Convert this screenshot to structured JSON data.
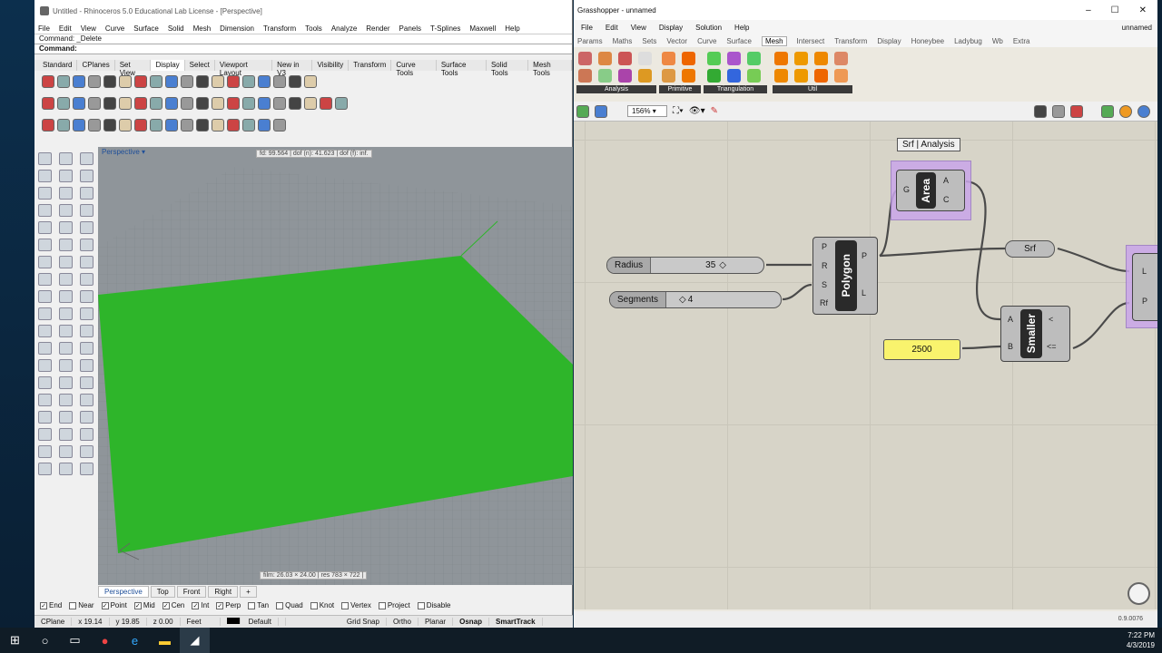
{
  "rhino": {
    "title": "Untitled - Rhinoceros 5.0 Educational Lab License - [Perspective]",
    "menu": [
      "File",
      "Edit",
      "View",
      "Curve",
      "Surface",
      "Solid",
      "Mesh",
      "Dimension",
      "Transform",
      "Tools",
      "Analyze",
      "Render",
      "Panels",
      "T-Splines",
      "Maxwell",
      "Help"
    ],
    "command_history": "Command: _Delete",
    "command_prompt": "Command:",
    "toolbar_tabs": [
      "Standard",
      "CPlanes",
      "Set View",
      "Display",
      "Select",
      "Viewport Layout",
      "New in V3",
      "Visibility",
      "Transform",
      "Curve Tools",
      "Surface Tools",
      "Solid Tools",
      "Mesh Tools"
    ],
    "active_tab": "Display",
    "viewport_title": "Perspective",
    "viewport_info_top": "fd: 99.564  |  dof (n): 41.623  |  dof (f): inf.",
    "viewport_info_bottom": "film: 26.03 × 24.00  |  res 783 × 722  |  ",
    "view_tabs": [
      "Perspective",
      "Top",
      "Front",
      "Right"
    ],
    "osnaps": [
      {
        "label": "End",
        "checked": true
      },
      {
        "label": "Near",
        "checked": false
      },
      {
        "label": "Point",
        "checked": true
      },
      {
        "label": "Mid",
        "checked": true
      },
      {
        "label": "Cen",
        "checked": true
      },
      {
        "label": "Int",
        "checked": true
      },
      {
        "label": "Perp",
        "checked": true
      },
      {
        "label": "Tan",
        "checked": false
      },
      {
        "label": "Quad",
        "checked": false
      },
      {
        "label": "Knot",
        "checked": false
      },
      {
        "label": "Vertex",
        "checked": false
      },
      {
        "label": "Project",
        "checked": false
      },
      {
        "label": "Disable",
        "checked": false
      }
    ],
    "status": {
      "cplane": "CPlane",
      "x": "x 19.14",
      "y": "y 19.85",
      "z": "z 0.00",
      "units": "Feet",
      "layer": "Default",
      "grid_snap": "Grid Snap",
      "ortho": "Ortho",
      "planar": "Planar",
      "osnap": "Osnap",
      "smarttrack": "SmartTrack"
    },
    "surface_color": "#2eb52a"
  },
  "gh": {
    "title": "Grasshopper - unnamed",
    "doc_name": "unnamed",
    "menu": [
      "File",
      "Edit",
      "View",
      "Display",
      "Solution",
      "Help"
    ],
    "tabs": [
      "Params",
      "Maths",
      "Sets",
      "Vector",
      "Curve",
      "Surface",
      "Mesh",
      "Intersect",
      "Transform",
      "Display",
      "Honeybee",
      "Ladybug",
      "Wb",
      "Extra"
    ],
    "active_tab": "Mesh",
    "ribbon_groups": [
      "Analysis",
      "Primitive",
      "Triangulation",
      "Util"
    ],
    "zoom": "156%",
    "group_label": "Srf | Analysis",
    "area": {
      "name": "Area",
      "in": [
        "G"
      ],
      "out": [
        "A",
        "C"
      ]
    },
    "polygon": {
      "name": "Polygon",
      "in": [
        "P",
        "R",
        "S",
        "Rf"
      ],
      "out": [
        "P",
        "L"
      ]
    },
    "smaller": {
      "name": "Smaller",
      "in": [
        "A",
        "B"
      ],
      "out": [
        "<",
        "<="
      ]
    },
    "radius_slider": {
      "label": "Radius",
      "value": "35"
    },
    "segments_slider": {
      "label": "Segments",
      "value": "4"
    },
    "panel_value": "2500",
    "srf_param": "Srf",
    "partial_out": [
      "L",
      "P"
    ],
    "version": "0.9.0076"
  },
  "taskbar": {
    "time": "7:22 PM",
    "date": "4/3/2019"
  }
}
